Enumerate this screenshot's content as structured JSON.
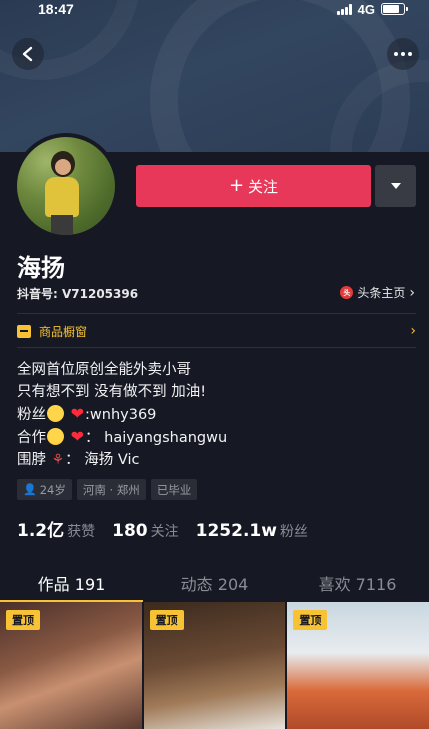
{
  "status_bar": {
    "time": "18:47",
    "network": "4G",
    "battery_level": 0.8
  },
  "profile": {
    "username": "海扬",
    "douyin_id": "抖音号: V71205396",
    "toutiao_link": "头条主页",
    "follow_button": "关注",
    "shop_window": "商品橱窗"
  },
  "bio": {
    "line1": "全网首位原创全能外卖小哥",
    "line2": "只有想不到 没有做不到 加油!",
    "line3_prefix": "粉丝",
    "line3_suffix": ":wnhy369",
    "line4_prefix": "合作",
    "line4_suffix": "： haiyangshangwu",
    "line5_prefix": "围脖",
    "line5_suffix": "： 海扬 Vic"
  },
  "tags": [
    "24岁",
    "河南 · 郑州",
    "已毕业"
  ],
  "stats": [
    {
      "num": "1.2亿",
      "label": "获赞"
    },
    {
      "num": "180",
      "label": "关注"
    },
    {
      "num": "1252.1w",
      "label": "粉丝"
    }
  ],
  "tabs": [
    "作品 191",
    "动态 204",
    "喜欢 7116"
  ],
  "videos": [
    {
      "badge": "置顶"
    },
    {
      "badge": "置顶"
    },
    {
      "badge": "置顶"
    }
  ],
  "colors": {
    "accent": "#fe2c55",
    "highlight": "#f7c234",
    "background": "#161823"
  }
}
